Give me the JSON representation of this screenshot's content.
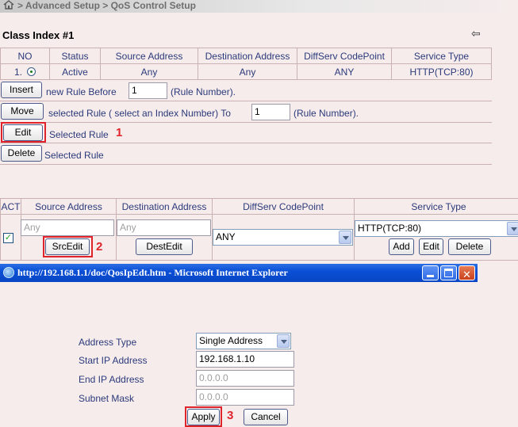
{
  "breadcrumb": "> Advanced Setup > QoS Control Setup",
  "class_title": "Class Index #1",
  "rules_table": {
    "headers": [
      "NO",
      "Status",
      "Source Address",
      "Destination Address",
      "DiffServ CodePoint",
      "Service Type"
    ],
    "row": {
      "no": "1.",
      "status": "Active",
      "source": "Any",
      "destination": "Any",
      "diffserv": "ANY",
      "service": "HTTP(TCP:80)"
    }
  },
  "actions": {
    "insert_label": "Insert",
    "insert_text": "new Rule Before",
    "insert_value": "1",
    "insert_suffix": "(Rule Number).",
    "move_label": "Move",
    "move_text": "selected Rule ( select an Index Number) To",
    "move_value": "1",
    "move_suffix": "(Rule Number).",
    "edit_label": "Edit",
    "edit_text": "Selected Rule",
    "delete_label": "Delete",
    "delete_text": "Selected Rule"
  },
  "edit_table": {
    "headers": [
      "ACT",
      "Source Address",
      "Destination Address",
      "DiffServ CodePoint",
      "Service Type"
    ],
    "source_value": "Any",
    "dest_value": "Any",
    "src_edit_label": "SrcEdit",
    "dest_edit_label": "DestEdit",
    "diffserv_value": "ANY",
    "service_value": "HTTP(TCP:80)",
    "add_label": "Add",
    "edit_label": "Edit",
    "delete_label": "Delete"
  },
  "ie_window": {
    "title": "http://192.168.1.1/doc/QosIpEdt.htm - Microsoft Internet Explorer"
  },
  "popup": {
    "address_type_label": "Address Type",
    "address_type_value": "Single Address",
    "start_ip_label": "Start IP Address",
    "start_ip_value": "192.168.1.10",
    "end_ip_label": "End IP Address",
    "end_ip_value": "0.0.0.0",
    "subnet_mask_label": "Subnet Mask",
    "subnet_mask_value": "0.0.0.0",
    "apply_label": "Apply",
    "cancel_label": "Cancel"
  },
  "steps": {
    "one": "1",
    "two": "2",
    "three": "3"
  },
  "colors": {
    "highlight": "#e0222a",
    "text": "#2b3a7a",
    "titlebar": "#0a4fd6"
  }
}
